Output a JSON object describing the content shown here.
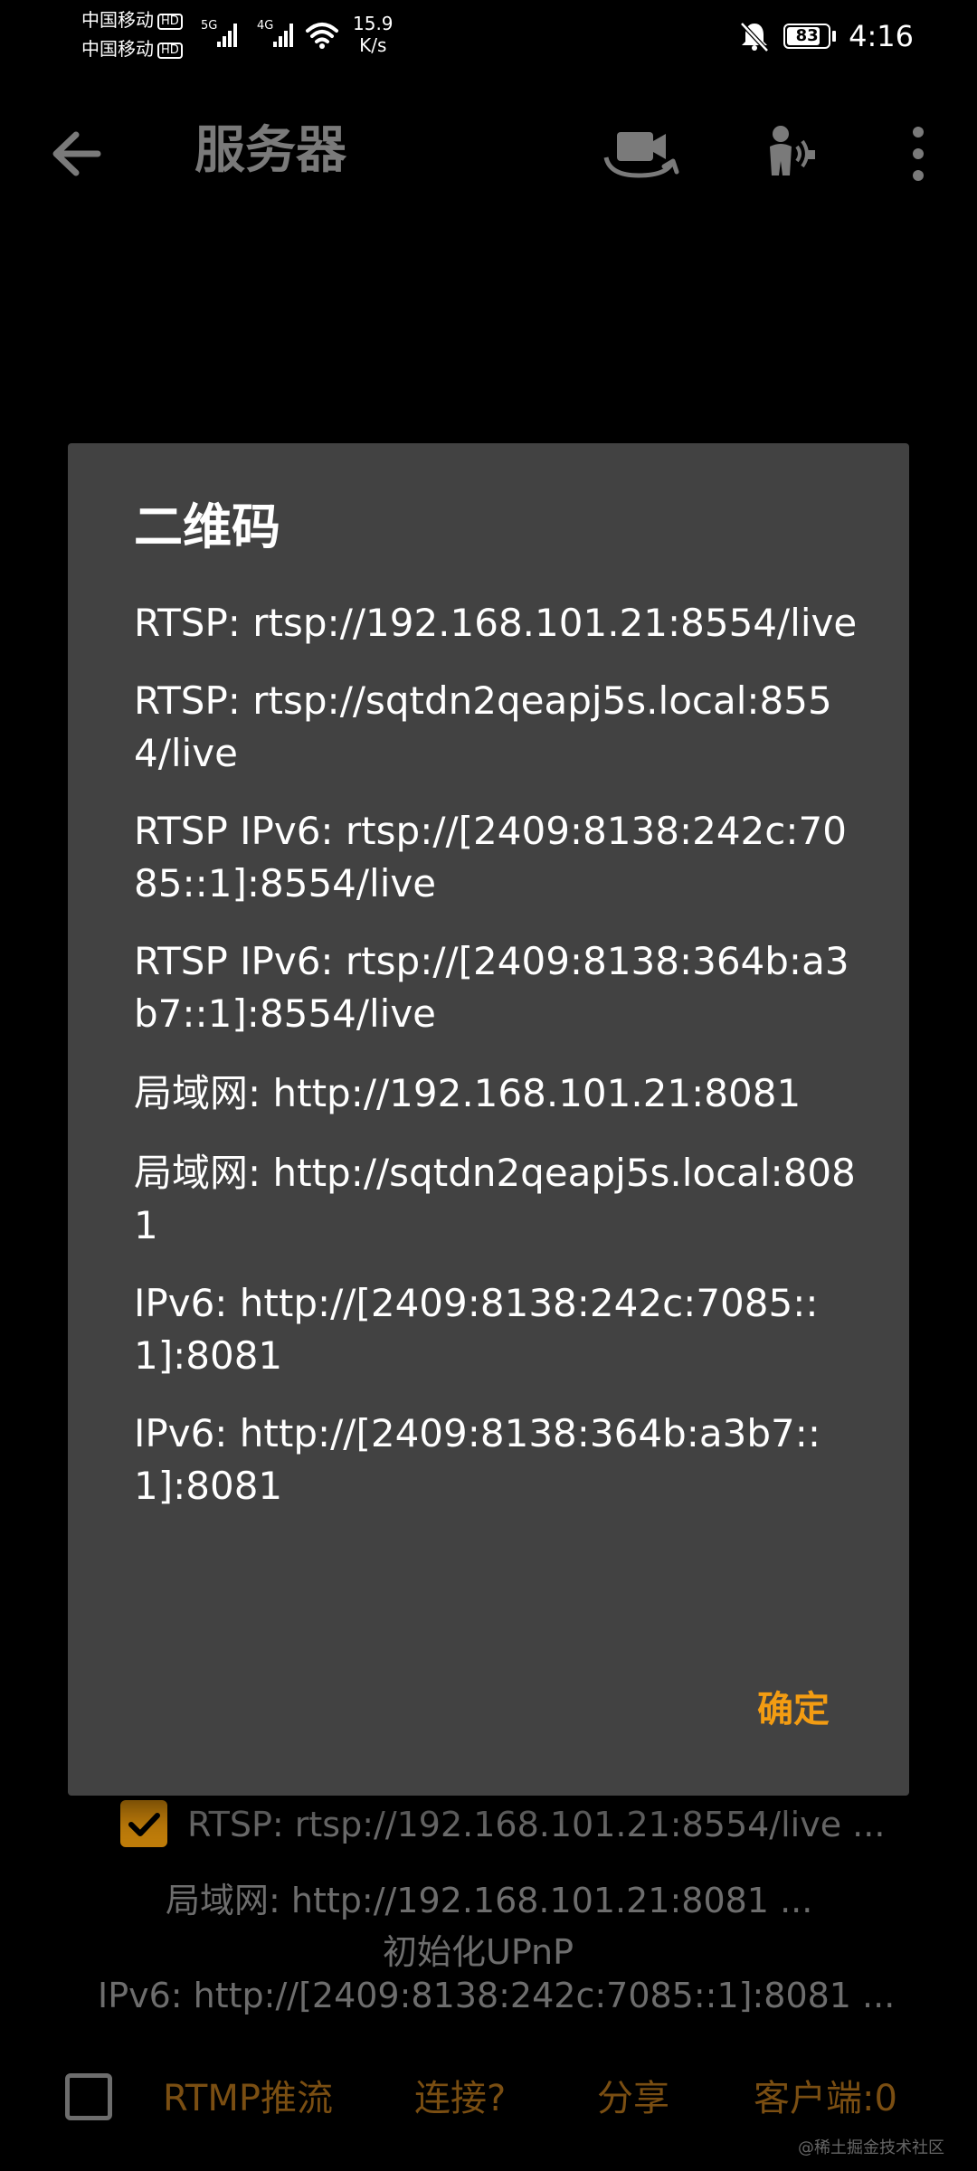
{
  "status_bar": {
    "carrier1": "中国移动",
    "carrier2": "中国移动",
    "hd_badge": "HD",
    "net1": "5G",
    "net2": "4G",
    "speed_value": "15.9",
    "speed_unit": "K/s",
    "battery": "83",
    "time": "4:16"
  },
  "app_bar": {
    "title": "服务器",
    "icons": [
      "back-arrow-icon",
      "switch-camera-icon",
      "voice-icon",
      "more-vert-icon"
    ]
  },
  "dialog": {
    "title": "二维码",
    "lines": [
      "RTSP: rtsp://192.168.101.21:8554/live",
      "RTSP: rtsp://sqtdn2qeapj5s.local:8554/live",
      "RTSP IPv6: rtsp://[2409:8138:242c:7085::1]:8554/live",
      "RTSP IPv6: rtsp://[2409:8138:364b:a3b7::1]:8554/live",
      "局域网: http://192.168.101.21:8081",
      "局域网: http://sqtdn2qeapj5s.local:8081",
      "IPv6: http://[2409:8138:242c:7085::1]:8081",
      "IPv6: http://[2409:8138:364b:a3b7::1]:8081"
    ],
    "ok_label": "确定"
  },
  "background": {
    "rtsp_summary": "RTSP: rtsp://192.168.101.21:8554/live ...",
    "lan_summary": "局域网: http://192.168.101.21:8081 ...",
    "upnp_label": "初始化UPnP",
    "ipv6_summary": "IPv6: http://[2409:8138:242c:7085::1]:8081 ...",
    "rtsp_checkbox_checked": true,
    "bottom_checkbox_checked": false
  },
  "bottom_bar": {
    "rtmp_label": "RTMP推流",
    "connect_label": "连接?",
    "share_label": "分享",
    "clients_label": "客户端:0"
  },
  "watermark": "@稀土掘金技术社区",
  "colors": {
    "accent": "#f39c12",
    "dialog_bg": "#424242",
    "muted_text": "#6d6d6d",
    "bottom_text": "#7a4e12"
  }
}
